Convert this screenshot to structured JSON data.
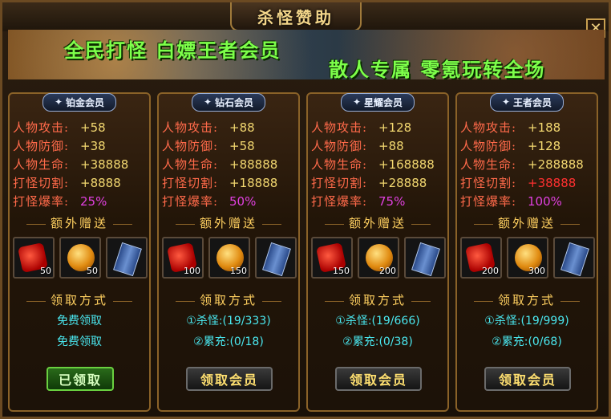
{
  "window": {
    "title": "杀怪赞助",
    "close_label": "✕"
  },
  "banner": {
    "line1": "全民打怪 白嫖王者会员",
    "line2": "散人专属 零氪玩转全场"
  },
  "labels": {
    "attack": "人物攻击:",
    "defense": "人物防御:",
    "life": "人物生命:",
    "cut": "打怪切割:",
    "crit": "打怪爆率:",
    "extra": "额外赠送",
    "method": "领取方式"
  },
  "cards": [
    {
      "name": "铂金会员",
      "attack": "+58",
      "defense": "+38",
      "life": "+38888",
      "cut": "+8888",
      "crit": "25%",
      "items": [
        "50",
        "50",
        ""
      ],
      "cond1": "免费领取",
      "cond2": "免费领取",
      "button": "已领取"
    },
    {
      "name": "钻石会员",
      "attack": "+88",
      "defense": "+58",
      "life": "+88888",
      "cut": "+18888",
      "crit": "50%",
      "items": [
        "100",
        "150",
        ""
      ],
      "cond1": "①杀怪:(19/333)",
      "cond2": "②累充:(0/18)",
      "button": "领取会员"
    },
    {
      "name": "星耀会员",
      "attack": "+128",
      "defense": "+88",
      "life": "+168888",
      "cut": "+28888",
      "crit": "75%",
      "items": [
        "150",
        "200",
        ""
      ],
      "cond1": "①杀怪:(19/666)",
      "cond2": "②累充:(0/38)",
      "button": "领取会员"
    },
    {
      "name": "王者会员",
      "attack": "+188",
      "defense": "+128",
      "life": "+288888",
      "cut": "+38888",
      "crit": "100%",
      "items": [
        "200",
        "300",
        ""
      ],
      "cond1": "①杀怪:(19/999)",
      "cond2": "②累充:(0/68)",
      "button": "领取会员"
    }
  ]
}
